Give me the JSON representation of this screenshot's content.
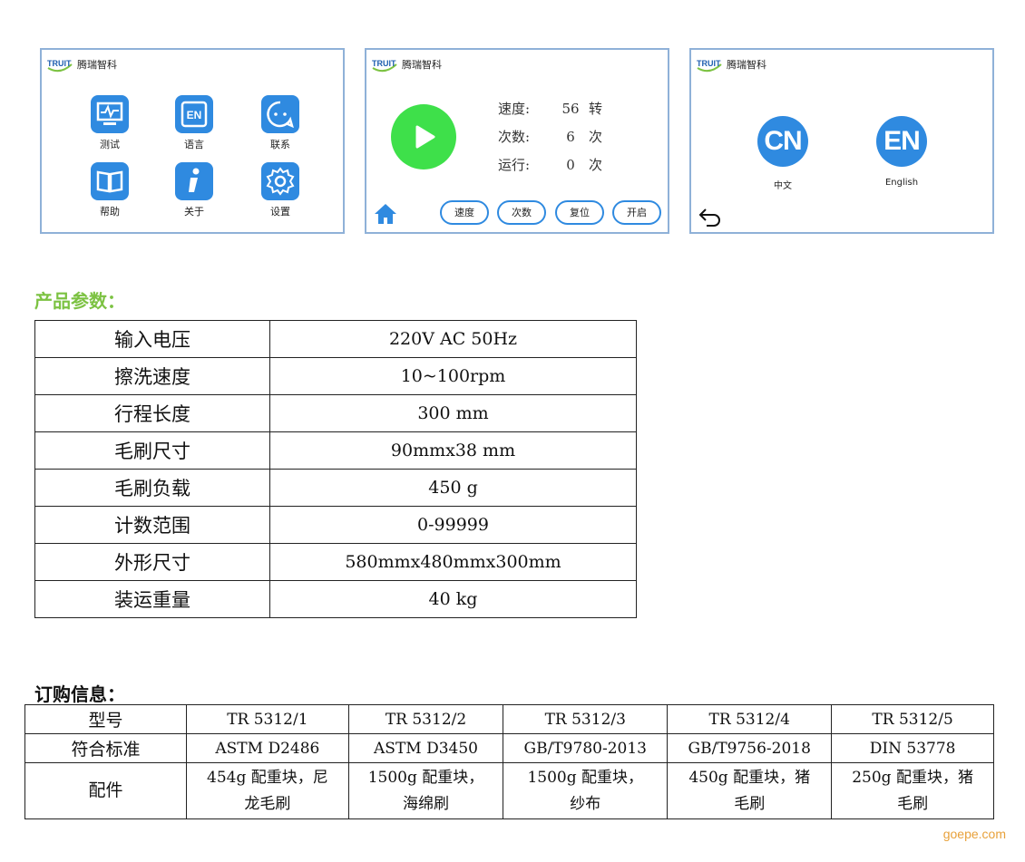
{
  "brand": {
    "logo_text": "TRUIT",
    "name": "腾瑞智科"
  },
  "menu_screen": {
    "items": [
      {
        "label": "测试",
        "icon": "monitor-chart-icon"
      },
      {
        "label": "语言",
        "icon": "language-en-icon"
      },
      {
        "label": "联系",
        "icon": "chat-bubble-icon"
      },
      {
        "label": "帮助",
        "icon": "book-icon"
      },
      {
        "label": "关于",
        "icon": "info-icon"
      },
      {
        "label": "设置",
        "icon": "gear-icon"
      }
    ]
  },
  "run_screen": {
    "stats": [
      {
        "label": "速度:",
        "value": "56",
        "unit": "转"
      },
      {
        "label": "次数:",
        "value": "6",
        "unit": "次"
      },
      {
        "label": "运行:",
        "value": "0",
        "unit": "次"
      }
    ],
    "buttons": [
      "速度",
      "次数",
      "复位",
      "开启"
    ],
    "colors": {
      "play": "#3ee04a",
      "accent": "#2f8ae0"
    }
  },
  "lang_screen": {
    "options": [
      {
        "badge": "CN",
        "label": "中文"
      },
      {
        "badge": "EN",
        "label": "English"
      }
    ]
  },
  "params": {
    "title": "产品参数：",
    "rows": [
      {
        "key": "输入电压",
        "value": "220V AC 50Hz"
      },
      {
        "key": "擦洗速度",
        "value": "10~100rpm"
      },
      {
        "key": "行程长度",
        "value": "300 mm"
      },
      {
        "key": "毛刷尺寸",
        "value": "90mmx38 mm"
      },
      {
        "key": "毛刷负载",
        "value": "450 g"
      },
      {
        "key": "计数范围",
        "value": "0-99999"
      },
      {
        "key": "外形尺寸",
        "value": "580mmx480mmx300mm"
      },
      {
        "key": "装运重量",
        "value": "40 kg"
      }
    ]
  },
  "order": {
    "title": "订购信息：",
    "row_headers": [
      "型号",
      "符合标准",
      "配件"
    ],
    "models": [
      "TR 5312/1",
      "TR 5312/2",
      "TR 5312/3",
      "TR 5312/4",
      "TR 5312/5"
    ],
    "standards": [
      "ASTM D2486",
      "ASTM D3450",
      "GB/T9780-2013",
      "GB/T9756-2018",
      "DIN 53778"
    ],
    "accessories": [
      [
        "454g 配重块，尼",
        "龙毛刷"
      ],
      [
        "1500g 配重块，",
        "海绵刷"
      ],
      [
        "1500g 配重块，",
        "纱布"
      ],
      [
        "450g 配重块，猪",
        "毛刷"
      ],
      [
        "250g 配重块，猪",
        "毛刷"
      ]
    ]
  },
  "watermark": "goepe.com"
}
